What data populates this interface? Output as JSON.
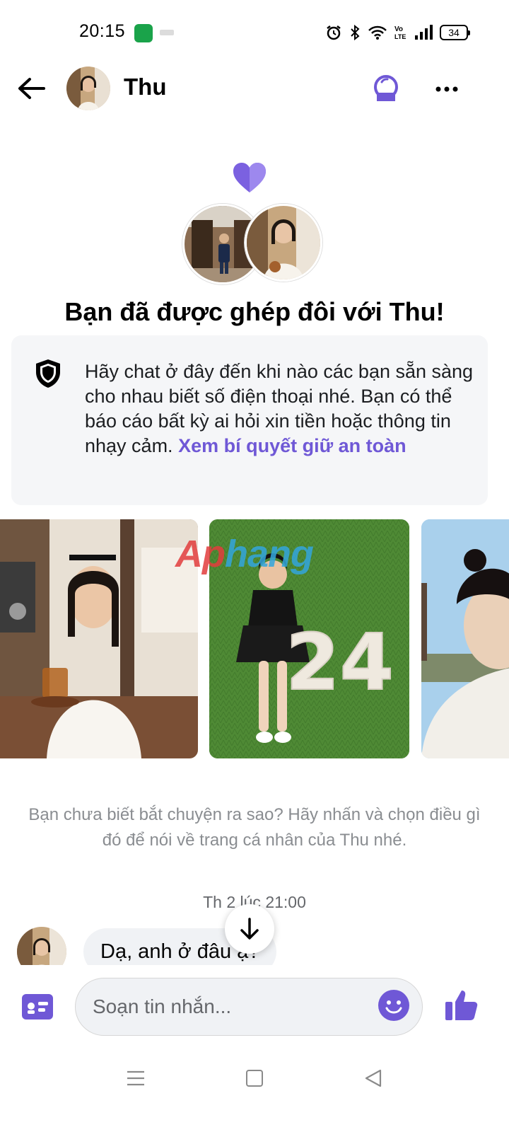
{
  "status_bar": {
    "time": "20:15",
    "battery": "34",
    "icons": [
      "alarm-icon",
      "bluetooth-icon",
      "wifi-icon",
      "volte-icon",
      "signal-icon",
      "battery-icon"
    ]
  },
  "header": {
    "name": "Thu",
    "icons": [
      "back-arrow-icon",
      "video-call-icon",
      "more-icon"
    ]
  },
  "match": {
    "title": "Bạn đã được ghép đôi với Thu!",
    "heart_color": "#7b61e0"
  },
  "safety": {
    "text": "Hãy chat ở đây đến khi nào các bạn sẵn sàng cho nhau biết số điện thoại nhé. Bạn có thể báo cáo bất kỳ ai hỏi xin tiền hoặc thông tin nhạy cảm.",
    "link": "Xem bí quyết giữ an toàn"
  },
  "watermark": {
    "part1": "Ap",
    "part2": "hang"
  },
  "prompt": "Bạn chưa biết bắt chuyện ra sao? Hãy nhấn và chọn điều gì đó để nói về trang cá nhân của Thu nhé.",
  "conversation": {
    "timestamp": "Th 2 lúc 21:00",
    "message": "Dạ, anh ở đâu ạ?"
  },
  "composer": {
    "placeholder": "Soạn tin nhắn..."
  },
  "colors": {
    "accent": "#6f58d6",
    "bubble": "#f0f2f5"
  }
}
